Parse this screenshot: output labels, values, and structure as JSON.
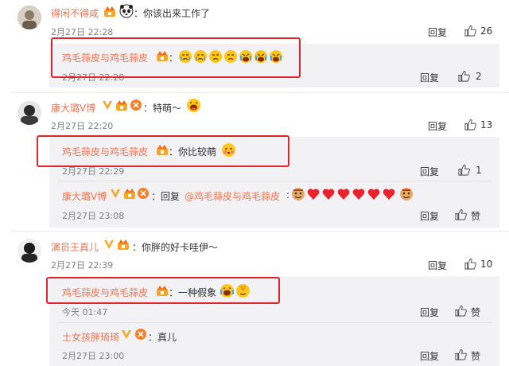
{
  "comments": [
    {
      "user": "得闲不得咸",
      "text": "：你该出来工作了",
      "time": "2月27日 22:28",
      "reply_label": "回复",
      "likes": "26",
      "replies": [
        {
          "user": "鸡毛蒜皮与鸡毛蒜皮",
          "text": "：",
          "time": "2月27日 22:28",
          "reply_label": "回复",
          "likes": "2"
        }
      ]
    },
    {
      "user": "康大璐V博",
      "text": "：特萌～",
      "time": "2月27日 22:20",
      "reply_label": "回复",
      "likes": "13",
      "replies": [
        {
          "user": "鸡毛蒜皮与鸡毛蒜皮",
          "text": "：你比较萌",
          "time": "2月27日 22:29",
          "reply_label": "回复",
          "likes": "1"
        },
        {
          "user": "康大璐V博",
          "text": "：回复",
          "mention": "@鸡毛蒜皮与鸡毛蒜皮",
          "colon": ":",
          "time": "2月27日 23:08",
          "reply_label": "回复",
          "likes": "赞"
        }
      ]
    },
    {
      "user": "演员王真儿",
      "text": "：你胖的好卡哇伊～",
      "time": "2月27日 22:39",
      "reply_label": "回复",
      "likes": "10",
      "replies": [
        {
          "user": "鸡毛蒜皮与鸡毛蒜皮",
          "text": "：一种假象",
          "time": "今天 01:47",
          "reply_label": "回复",
          "likes": "赞"
        },
        {
          "user": "土女孩胖琦琦",
          "text": "：真儿",
          "time": "2月27日 23:00",
          "reply_label": "回复",
          "likes": "赞"
        }
      ]
    }
  ],
  "colors": {
    "username": "#eb7350",
    "reply_bg": "#f2f2f5",
    "highlight_box": "#e0242c",
    "timestamp": "#808080",
    "vip_v": "#f5a623"
  },
  "icons": [
    "thumb-up-icon",
    "member-crown-icon",
    "v-verified-icon",
    "panda-emoji",
    "weep-emoji",
    "laugh-emoji",
    "heart-emoji",
    "smile-emoji"
  ]
}
